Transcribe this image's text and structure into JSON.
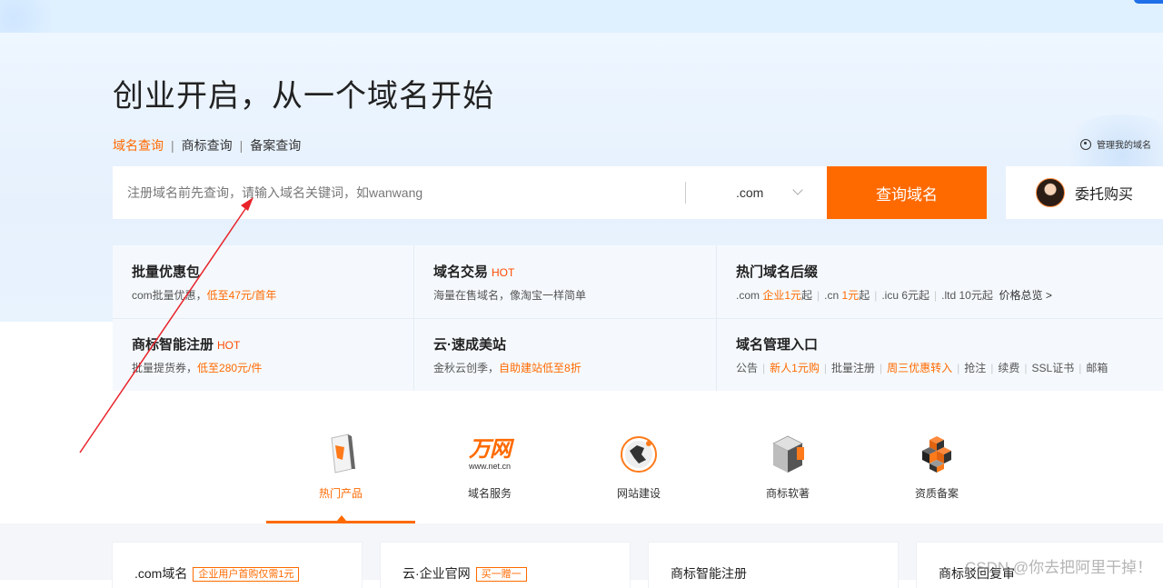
{
  "hero": {
    "title": "创业开启，从一个域名开始",
    "tabs": [
      {
        "label": "域名查询",
        "active": true
      },
      {
        "label": "商标查询",
        "active": false
      },
      {
        "label": "备案查询",
        "active": false
      }
    ],
    "tab_separator": "|",
    "manage_link": "管理我的域名"
  },
  "search": {
    "placeholder": "注册域名前先查询，请输入域名关键词，如wanwang",
    "suffix": ".com",
    "button_label": "查询域名",
    "entrust_label": "委托购买"
  },
  "cards": [
    {
      "title": "批量优惠包",
      "hot": "",
      "sub_parts": [
        {
          "text": "com批量优惠，"
        },
        {
          "text": "低至47元/首年",
          "highlight": true
        }
      ]
    },
    {
      "title": "域名交易",
      "hot": "HOT",
      "sub_parts": [
        {
          "text": "海量在售域名，像淘宝一样简单"
        }
      ]
    },
    {
      "title": "热门域名后缀",
      "hot": "",
      "sub_parts": [
        {
          "text": ".com "
        },
        {
          "text": "企业1元",
          "highlight": true
        },
        {
          "text": "起"
        },
        {
          "sep": true
        },
        {
          "text": ".cn "
        },
        {
          "text": "1元",
          "highlight": true
        },
        {
          "text": "起"
        },
        {
          "sep": true
        },
        {
          "text": ".icu 6元起"
        },
        {
          "sep": true
        },
        {
          "text": ".ltd 10元起"
        },
        {
          "text": "  价格总览 >",
          "link": true
        }
      ]
    },
    {
      "title": "商标智能注册",
      "hot": "HOT",
      "sub_parts": [
        {
          "text": "批量提货券，"
        },
        {
          "text": "低至280元/件",
          "highlight": true
        }
      ]
    },
    {
      "title": "云·速成美站",
      "hot": "",
      "sub_parts": [
        {
          "text": "金秋云创季，"
        },
        {
          "text": "自助建站低至8折",
          "highlight": true
        }
      ]
    },
    {
      "title": "域名管理入口",
      "hot": "",
      "sub_parts": [
        {
          "text": "公告"
        },
        {
          "sep": true
        },
        {
          "text": "新人1元购",
          "highlight": true
        },
        {
          "sep": true
        },
        {
          "text": "批量注册"
        },
        {
          "sep": true
        },
        {
          "text": "周三优惠转入",
          "highlight": true
        },
        {
          "sep": true
        },
        {
          "text": "抢注"
        },
        {
          "sep": true
        },
        {
          "text": "续费"
        },
        {
          "sep": true
        },
        {
          "text": "SSL证书"
        },
        {
          "sep": true
        },
        {
          "text": "邮箱"
        }
      ]
    }
  ],
  "products": [
    {
      "label": "热门产品",
      "icon": "hot-product-icon",
      "active": true
    },
    {
      "label": "域名服务",
      "icon": "wanwang-logo-icon",
      "logo_text": "万网",
      "logo_sub": "www.net.cn",
      "active": false
    },
    {
      "label": "网站建设",
      "icon": "globe-icon",
      "active": false
    },
    {
      "label": "商标软著",
      "icon": "trademark-cube-icon",
      "active": false
    },
    {
      "label": "资质备案",
      "icon": "qualification-cubes-icon",
      "active": false
    }
  ],
  "bottom_cards": [
    {
      "title": ".com域名",
      "tag": "企业用户首购仅需1元"
    },
    {
      "title": "云·企业官网",
      "tag": "买一赠一"
    },
    {
      "title": "商标智能注册",
      "tag": ""
    },
    {
      "title": "商标驳回复审",
      "tag": ""
    }
  ],
  "watermark": "CSDN @你去把阿里干掉！",
  "colors": {
    "accent": "#ff6a00",
    "hot": "#ff4a00",
    "annotation_arrow": "#e8232a"
  }
}
